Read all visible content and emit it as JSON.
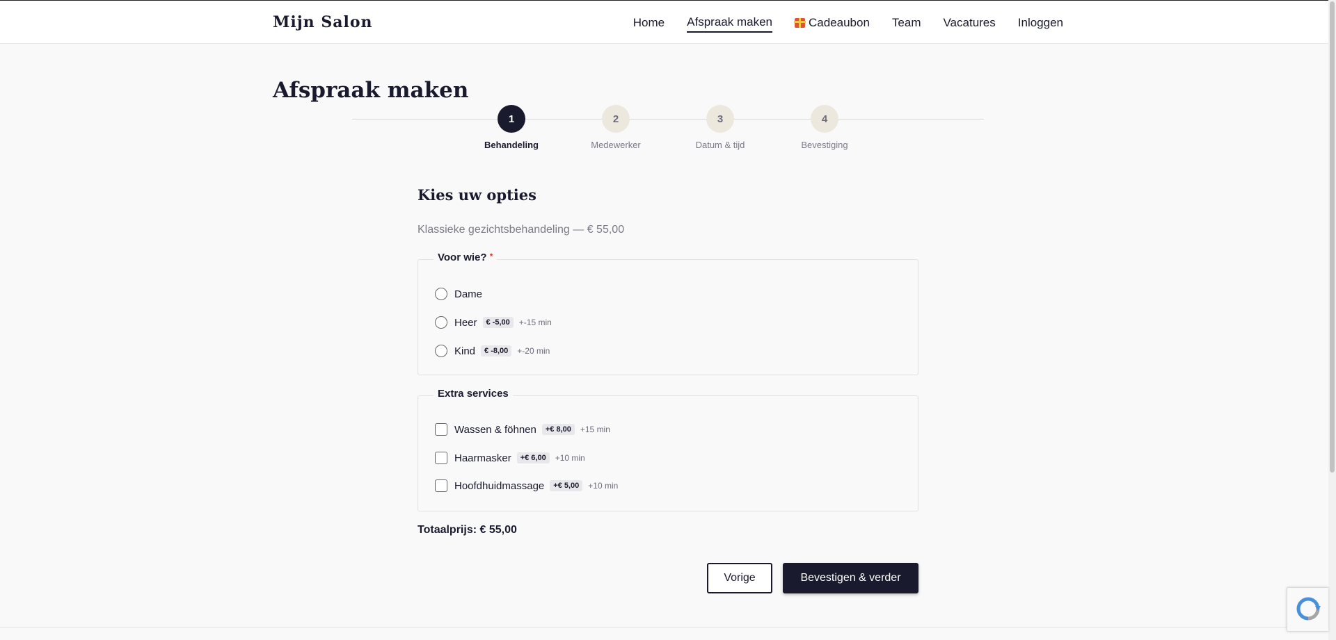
{
  "header": {
    "brand": "Mijn Salon",
    "nav": [
      {
        "label": "Home"
      },
      {
        "label": "Afspraak maken"
      },
      {
        "label": "Cadeaubon"
      },
      {
        "label": "Team"
      },
      {
        "label": "Vacatures"
      },
      {
        "label": "Inloggen"
      }
    ]
  },
  "page": {
    "title": "Afspraak maken"
  },
  "stepper": {
    "steps": [
      {
        "number": "1",
        "label": "Behandeling"
      },
      {
        "number": "2",
        "label": "Medewerker"
      },
      {
        "number": "3",
        "label": "Datum & tijd"
      },
      {
        "number": "4",
        "label": "Bevestiging"
      }
    ]
  },
  "form": {
    "section_title": "Kies uw opties",
    "service": "Klassieke gezichtsbehandeling — € 55,00",
    "for_whom": {
      "legend": "Voor wie?",
      "required_mark": "*",
      "options": [
        {
          "label": "Dame"
        },
        {
          "label": "Heer",
          "price": "€ -5,00",
          "time": "+-15 min"
        },
        {
          "label": "Kind",
          "price": "€ -8,00",
          "time": "+-20 min"
        }
      ]
    },
    "extras": {
      "legend": "Extra services",
      "options": [
        {
          "label": "Wassen & föhnen",
          "price": "+€ 8,00",
          "time": "+15 min"
        },
        {
          "label": "Haarmasker",
          "price": "+€ 6,00",
          "time": "+10 min"
        },
        {
          "label": "Hoofdhuidmassage",
          "price": "+€ 5,00",
          "time": "+10 min"
        }
      ]
    },
    "total": "Totaalprijs: € 55,00",
    "prev_label": "Vorige",
    "next_label": "Bevestigen & verder"
  },
  "colors": {
    "primary": "#1a1a2e",
    "background": "#f9f9f9",
    "step_inactive": "#ece8de"
  }
}
